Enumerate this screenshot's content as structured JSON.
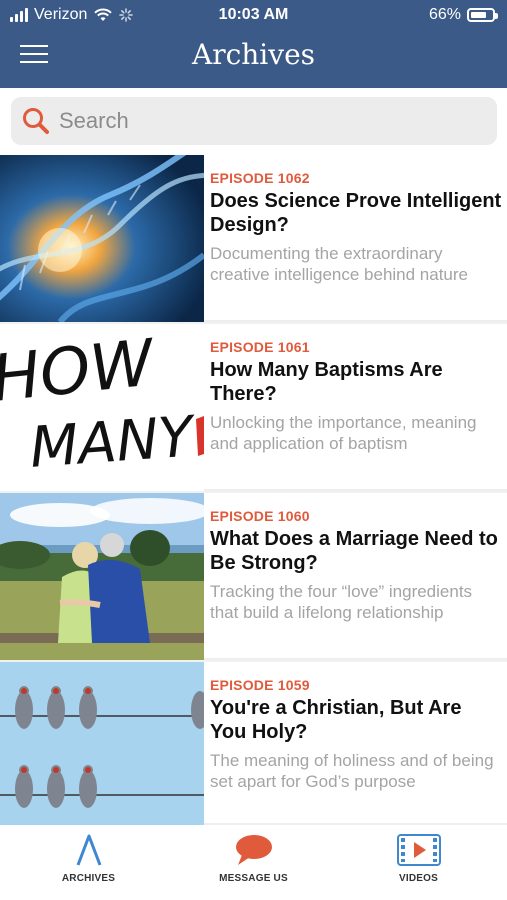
{
  "status": {
    "carrier": "Verizon",
    "time": "10:03 AM",
    "battery": "66%"
  },
  "header": {
    "title": "Archives",
    "menu_icon": "hamburger-icon"
  },
  "search": {
    "placeholder": "Search",
    "value": ""
  },
  "episodes": [
    {
      "episode": "EPISODE 1062",
      "title": "Does Science Prove Intelligent Design?",
      "description": "Documenting the extraordinary creative intelligence behind nature"
    },
    {
      "episode": "EPISODE 1061",
      "title": "How Many Baptisms Are There?",
      "description": "Unlocking the importance, meaning and application of baptism",
      "thumb_text": [
        "HOW",
        "MANY"
      ]
    },
    {
      "episode": "EPISODE 1060",
      "title": "What Does a Marriage Need to Be Strong?",
      "description": "Tracking the four “love” ingredients that build a lifelong relationship"
    },
    {
      "episode": "EPISODE 1059",
      "title": "You're a Christian, But Are You Holy?",
      "description": "The meaning of holiness and of being set apart for God’s purpose"
    }
  ],
  "tabs": [
    {
      "label": "ARCHIVES",
      "icon": "archive-a-icon"
    },
    {
      "label": "MESSAGE US",
      "icon": "chat-bubble-icon"
    },
    {
      "label": "VIDEOS",
      "icon": "film-play-icon"
    }
  ],
  "colors": {
    "header": "#3b5a87",
    "accent": "#e05a3c",
    "tab_blue": "#3f87cf"
  }
}
